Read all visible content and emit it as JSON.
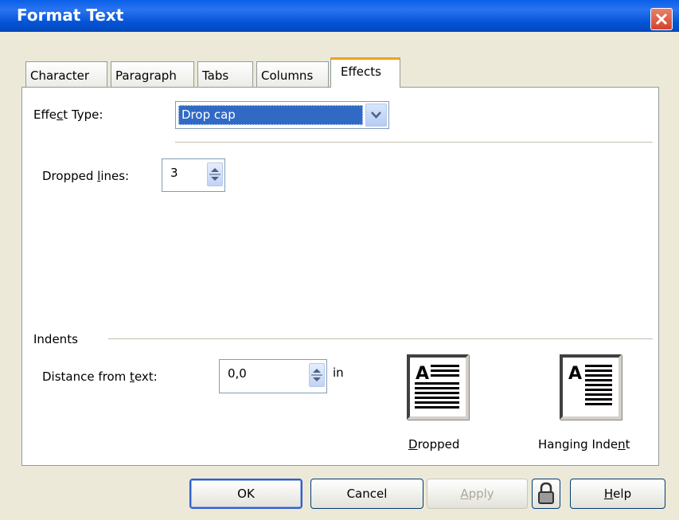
{
  "window": {
    "title": "Format Text"
  },
  "tabs": [
    {
      "label": "Character",
      "active": false
    },
    {
      "label": "Paragraph",
      "active": false
    },
    {
      "label": "Tabs",
      "active": false
    },
    {
      "label": "Columns",
      "active": false
    },
    {
      "label": "Effects",
      "active": true
    }
  ],
  "effect_type": {
    "label_pre": "Effe",
    "label_key": "c",
    "label_post": "t Type:",
    "value": "Drop cap"
  },
  "dropped_lines": {
    "label_pre": "Dropped ",
    "label_key": "l",
    "label_post": "ines:",
    "value": "3"
  },
  "indents": {
    "heading": "Indents",
    "distance": {
      "label_pre": "Distance from ",
      "label_key": "t",
      "label_post": "ext:",
      "value": "0,0",
      "unit": "in"
    },
    "options": [
      {
        "label_pre": "",
        "label_key": "D",
        "label_post": "ropped",
        "icon": "dropped-cap-preview-icon"
      },
      {
        "label_pre": "Hanging Inde",
        "label_key": "n",
        "label_post": "t",
        "icon": "hanging-indent-preview-icon"
      }
    ]
  },
  "buttons": {
    "ok": "OK",
    "cancel": "Cancel",
    "apply": {
      "key": "A",
      "rest": "pply"
    },
    "help": {
      "key": "H",
      "rest": "elp"
    }
  },
  "colors": {
    "title_bar": "#0454d8",
    "selection": "#316ac5",
    "active_tab_accent": "#f0a020",
    "close_button": "#d6422a"
  }
}
